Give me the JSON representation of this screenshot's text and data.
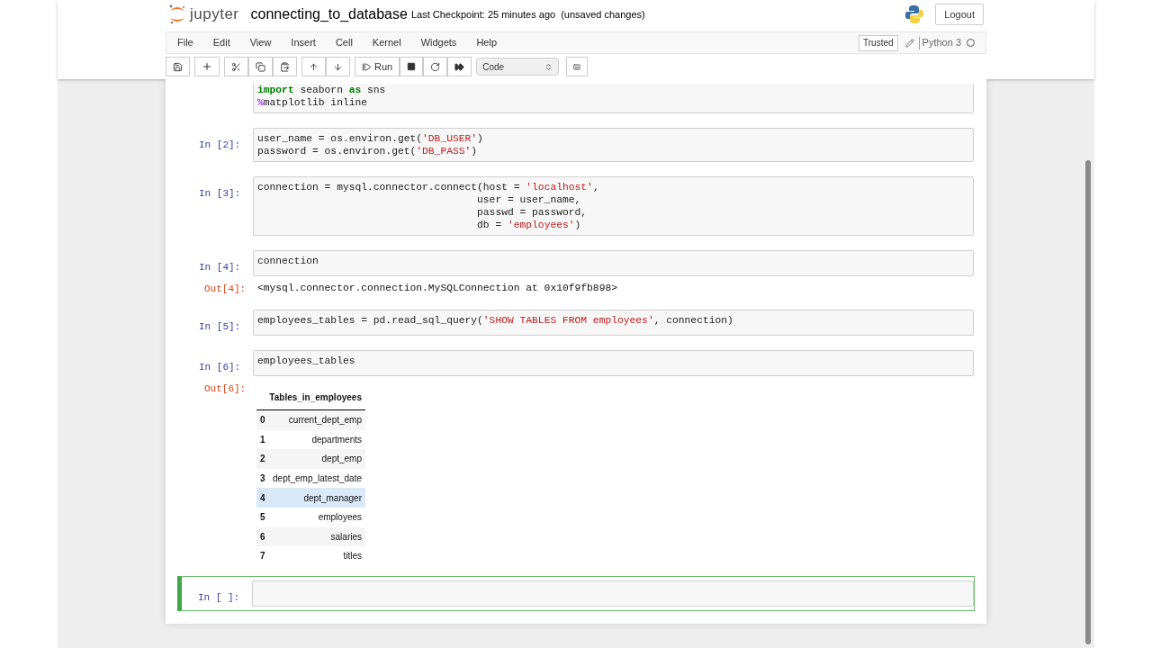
{
  "header": {
    "logo_text": "jupyter",
    "notebook_name": "connecting_to_database",
    "checkpoint": "Last Checkpoint: 25 minutes ago",
    "unsaved": "(unsaved changes)",
    "logout": "Logout"
  },
  "menu": [
    "File",
    "Edit",
    "View",
    "Insert",
    "Cell",
    "Kernel",
    "Widgets",
    "Help"
  ],
  "kernel": {
    "trusted": "Trusted",
    "name": "Python 3",
    "busy": false
  },
  "toolbar": {
    "run": "Run",
    "cell_type": "Code"
  },
  "cells": [
    {
      "selected": false,
      "lines": [
        [
          {
            "kind": "kw",
            "text": "import"
          },
          {
            "kind": "plain",
            "text": " seaborn "
          },
          {
            "kind": "kw",
            "text": "as"
          },
          {
            "kind": "plain",
            "text": " sns"
          }
        ],
        [
          {
            "kind": "magic",
            "text": "%"
          },
          {
            "kind": "plain",
            "text": "matplotlib inline"
          }
        ]
      ]
    },
    {
      "prompt": "In [2]:",
      "selected": false,
      "lines": [
        [
          {
            "kind": "plain",
            "text": "user_name = os.environ.get("
          },
          {
            "kind": "str",
            "text": "'DB_USER'"
          },
          {
            "kind": "plain",
            "text": ")"
          }
        ],
        [
          {
            "kind": "plain",
            "text": "password = os.environ.get("
          },
          {
            "kind": "str",
            "text": "'DB_PASS'"
          },
          {
            "kind": "plain",
            "text": ")"
          }
        ]
      ]
    },
    {
      "prompt": "In [3]:",
      "selected": false,
      "lines": [
        [
          {
            "kind": "plain",
            "text": "connection = mysql.connector.connect(host = "
          },
          {
            "kind": "str",
            "text": "'localhost'"
          },
          {
            "kind": "plain",
            "text": ","
          }
        ],
        [
          {
            "kind": "plain",
            "text": "                                    user = user_name,"
          }
        ],
        [
          {
            "kind": "plain",
            "text": "                                    passwd = password,"
          }
        ],
        [
          {
            "kind": "plain",
            "text": "                                    db = "
          },
          {
            "kind": "str",
            "text": "'employees'"
          },
          {
            "kind": "plain",
            "text": ")"
          }
        ]
      ]
    },
    {
      "prompt": "In [4]:",
      "selected": false,
      "lines": [
        [
          {
            "kind": "plain",
            "text": "connection"
          }
        ]
      ],
      "output": {
        "prompt": "Out[4]:",
        "kind": "text",
        "text": "<mysql.connector.connection.MySQLConnection at 0x10f9fb898>"
      }
    },
    {
      "prompt": "In [5]:",
      "selected": false,
      "lines": [
        [
          {
            "kind": "plain",
            "text": "employees_tables = pd.read_sql_query("
          },
          {
            "kind": "str",
            "text": "'SHOW TABLES FROM employees'"
          },
          {
            "kind": "plain",
            "text": ", connection)"
          }
        ]
      ]
    },
    {
      "prompt": "In [6]:",
      "selected": false,
      "lines": [
        [
          {
            "kind": "plain",
            "text": "employees_tables"
          }
        ]
      ],
      "output": {
        "prompt": "Out[6]:",
        "kind": "table",
        "column": "Tables_in_employees",
        "rows": [
          {
            "index": "0",
            "value": "current_dept_emp",
            "selected": false
          },
          {
            "index": "1",
            "value": "departments",
            "selected": false
          },
          {
            "index": "2",
            "value": "dept_emp",
            "selected": false
          },
          {
            "index": "3",
            "value": "dept_emp_latest_date",
            "selected": false
          },
          {
            "index": "4",
            "value": "dept_manager",
            "selected": true
          },
          {
            "index": "5",
            "value": "employees",
            "selected": false
          },
          {
            "index": "6",
            "value": "salaries",
            "selected": false
          },
          {
            "index": "7",
            "value": "titles",
            "selected": false
          }
        ]
      }
    },
    {
      "prompt": "In [ ]:",
      "selected": true
    }
  ]
}
